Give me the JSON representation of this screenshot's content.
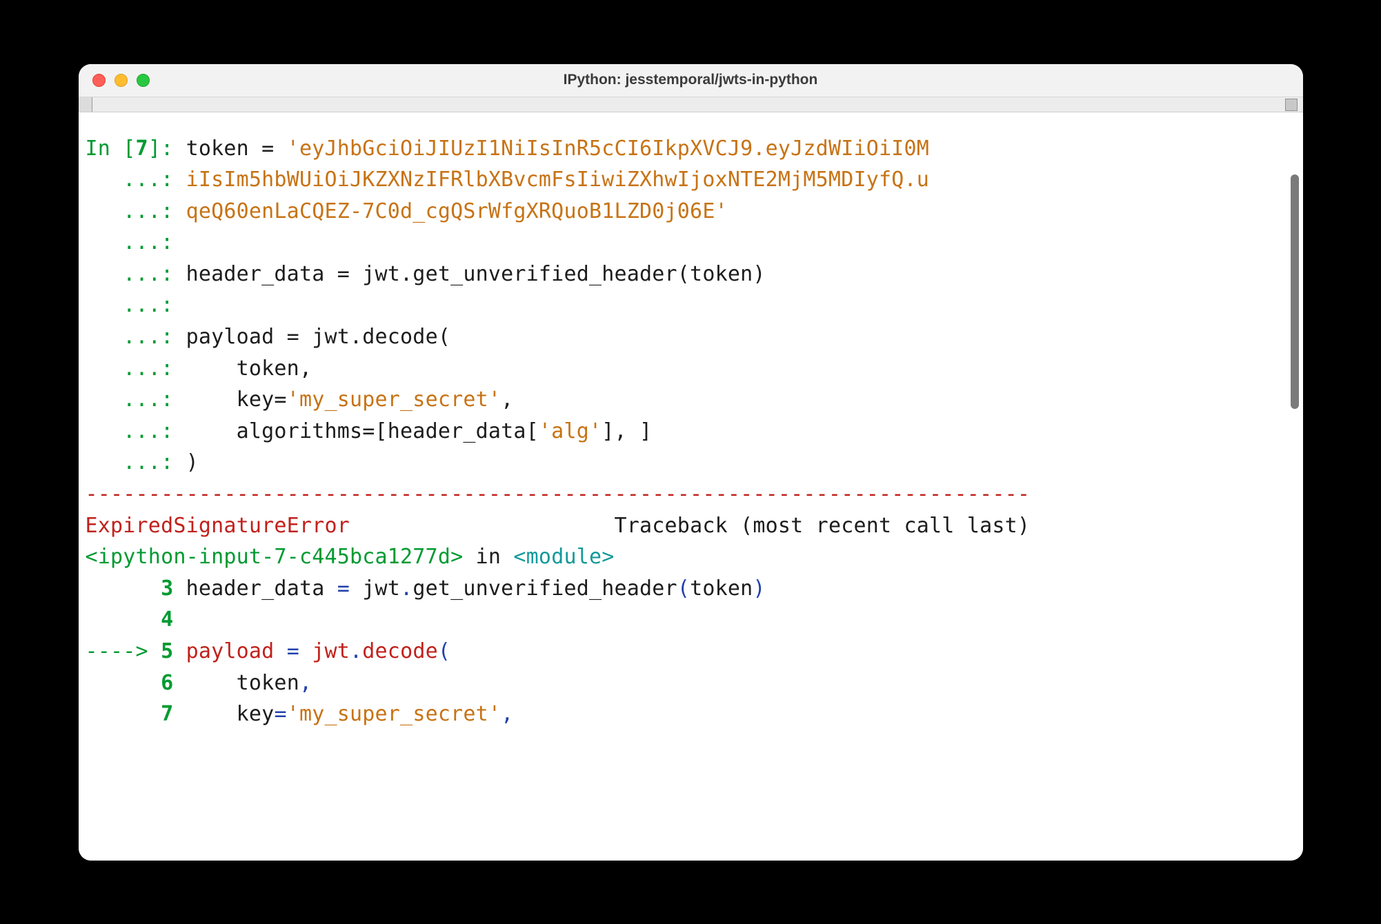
{
  "window": {
    "title": "IPython: jesstemporal/jwts-in-python"
  },
  "terminal": {
    "prompt_in": "In [",
    "prompt_num": "7",
    "prompt_close": "]: ",
    "cont": "   ...: ",
    "line1_a": "token = ",
    "line1_b": "'eyJhbGciOiJIUzI1NiIsInR5cCI6IkpXVCJ9.eyJzdWIiOiI0M",
    "line2": "iIsIm5hbWUiOiJKZXNzIFRlbXBvcmFsIiwiZXhwIjoxNTE2MjM5MDIyfQ.u",
    "line3": "qeQ60enLaCQEZ-7C0d_cgQSrWfgXRQuoB1LZD0j06E'",
    "line5": "header_data = jwt.get_unverified_header(token)",
    "line7": "payload = jwt.decode(",
    "line8": "    token,",
    "line9a": "    key=",
    "line9b": "'my_super_secret'",
    "line9c": ",",
    "line10a": "    algorithms=[header_data[",
    "line10b": "'alg'",
    "line10c": "], ]",
    "line11": ")",
    "sep": "---------------------------------------------------------------------------",
    "err_name": "ExpiredSignatureError",
    "err_spacer": "                     ",
    "err_trace": "Traceback (most recent call last)",
    "tb_loc": "<ipython-input-7-c445bca1277d>",
    "tb_in": " in ",
    "tb_mod": "<module>",
    "tb_indent": "      ",
    "tb_n3": "3",
    "tb_l3": " header_data ",
    "tb_l3b": "=",
    "tb_l3c": " jwt",
    "tb_l3d": ".",
    "tb_l3e": "get_unverified_header",
    "tb_l3f": "(",
    "tb_l3g": "token",
    "tb_l3h": ")",
    "tb_n4": "4",
    "tb_arrow": "----> ",
    "tb_n5": "5",
    "tb_l5": " payload ",
    "tb_l5b": "=",
    "tb_l5c": " jwt",
    "tb_l5d": ".",
    "tb_l5e": "decode",
    "tb_l5f": "(",
    "tb_n6": "6",
    "tb_l6": "     token",
    "tb_l6b": ",",
    "tb_n7": "7",
    "tb_l7a": "     key",
    "tb_l7b": "=",
    "tb_l7c": "'my_super_secret'",
    "tb_l7d": ","
  }
}
